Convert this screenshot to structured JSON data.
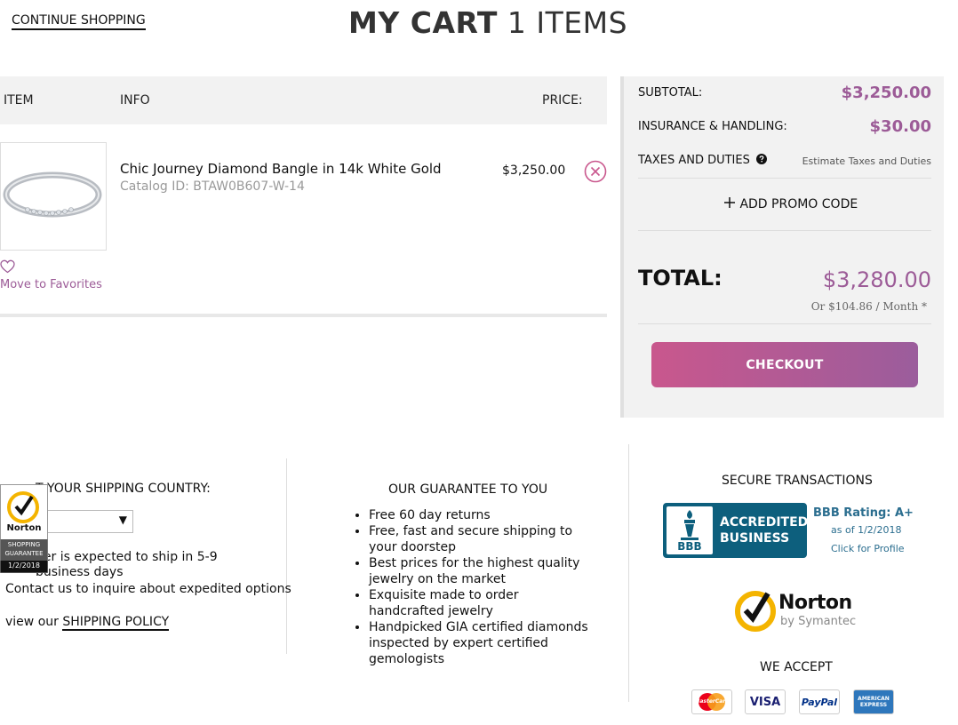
{
  "header": {
    "continue_label": "CONTINUE SHOPPING",
    "title_bold": "MY CART",
    "title_count": "1 ITEMS"
  },
  "table": {
    "headers": [
      "ITEM",
      "INFO",
      "PRICE:"
    ]
  },
  "item": {
    "name": "Chic Journey Diamond Bangle in 14k White Gold",
    "catalog": "Catalog ID: BTAW0B607-W-14",
    "price": "$3,250.00",
    "move_fav": "Move to Favorites"
  },
  "summary": {
    "subtotal_label": "SUBTOTAL:",
    "subtotal": "$3,250.00",
    "insurance_label": "INSURANCE & HANDLING:",
    "insurance": "$30.00",
    "taxes_label": "TAXES AND DUTIES",
    "taxes_link": "Estimate Taxes and Duties",
    "promo_label": "ADD PROMO CODE",
    "total_label": "TOTAL:",
    "total": "$3,280.00",
    "monthly": "Or  $104.86 / Month *",
    "checkout_label": "CHECKOUT"
  },
  "shipping": {
    "label": "T YOUR SHIPPING COUNTRY:",
    "note": "der is expected to ship in 5-9 business days",
    "contact": "Contact us to inquire about expedited options",
    "policy_prefix": "view our ",
    "policy_link": "SHIPPING POLICY",
    "badge_name": "Norton",
    "badge_line1": "SHOPPING",
    "badge_line2": "GUARANTEE",
    "badge_date": "1/2/2018"
  },
  "guarantee": {
    "title": "OUR GUARANTEE TO YOU",
    "items": [
      "Free 60 day returns",
      "Free, fast and secure shipping to your doorstep",
      "Best prices for the highest quality jewelry on the market",
      "Exquisite made to order handcrafted jewelry",
      "Handpicked GIA certified diamonds inspected by expert certified gemologists"
    ]
  },
  "secure": {
    "title": "SECURE TRANSACTIONS",
    "bbb_logo": "BBB",
    "bbb_line1": "ACCREDITED",
    "bbb_line2": "BUSINESS",
    "bbb_rating": "BBB Rating: A+",
    "bbb_date": "as of 1/2/2018",
    "bbb_click": "Click for Profile",
    "norton_name": "Norton",
    "norton_sub": "by Symantec",
    "accept_label": "WE ACCEPT",
    "cards": [
      "MasterCard",
      "VISA",
      "PayPal",
      "AMERICAN EXPRESS"
    ]
  },
  "colors": {
    "accent": "#9c5b97",
    "checkout_start": "#c9578d",
    "checkout_end": "#9b5d9c"
  }
}
